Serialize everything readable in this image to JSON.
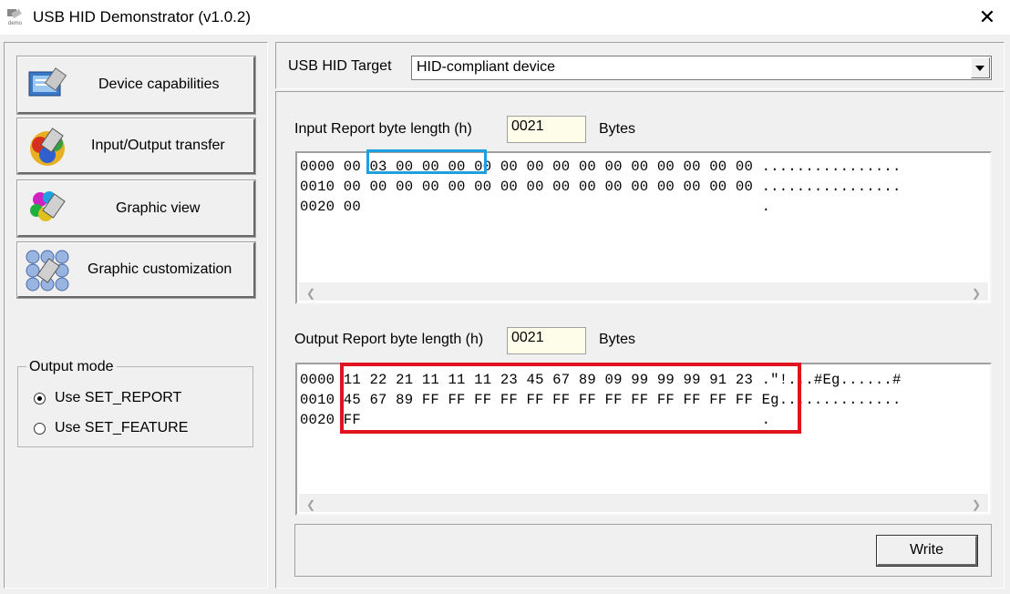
{
  "window": {
    "title": "USB HID Demonstrator (v1.0.2)",
    "close_glyph": "✕"
  },
  "sidebar": {
    "buttons": [
      {
        "label": "Device capabilities",
        "icon": "device-capabilities-icon"
      },
      {
        "label": "Input/Output transfer",
        "icon": "io-transfer-icon"
      },
      {
        "label": "Graphic view",
        "icon": "graphic-view-icon"
      },
      {
        "label": "Graphic customization",
        "icon": "graphic-customization-icon"
      }
    ],
    "output_mode": {
      "title": "Output mode",
      "options": [
        {
          "label": "Use SET_REPORT",
          "selected": true
        },
        {
          "label": "Use SET_FEATURE",
          "selected": false
        }
      ]
    }
  },
  "target": {
    "label": "USB HID Target",
    "value": "HID-compliant device"
  },
  "input_report": {
    "label": "Input Report byte length  (h)",
    "length": "0021",
    "unit": "Bytes",
    "rows": [
      {
        "addr": "0000",
        "bytes": [
          "00",
          "03",
          "00",
          "00",
          "00",
          "00",
          "00",
          "00",
          "00",
          "00",
          "00",
          "00",
          "00",
          "00",
          "00",
          "00"
        ],
        "ascii": "................"
      },
      {
        "addr": "0010",
        "bytes": [
          "00",
          "00",
          "00",
          "00",
          "00",
          "00",
          "00",
          "00",
          "00",
          "00",
          "00",
          "00",
          "00",
          "00",
          "00",
          "00"
        ],
        "ascii": "................"
      },
      {
        "addr": "0020",
        "bytes": [
          "00"
        ],
        "ascii": "."
      }
    ],
    "highlight_color": "#1f9fe0"
  },
  "output_report": {
    "label": "Output Report byte length  (h)",
    "length": "0021",
    "unit": "Bytes",
    "rows": [
      {
        "addr": "0000",
        "bytes": [
          "11",
          "22",
          "21",
          "11",
          "11",
          "11",
          "23",
          "45",
          "67",
          "89",
          "09",
          "99",
          "99",
          "99",
          "91",
          "23"
        ],
        "ascii": ".\"!...#Eg......#"
      },
      {
        "addr": "0010",
        "bytes": [
          "45",
          "67",
          "89",
          "FF",
          "FF",
          "FF",
          "FF",
          "FF",
          "FF",
          "FF",
          "FF",
          "FF",
          "FF",
          "FF",
          "FF",
          "FF"
        ],
        "ascii": "Eg.............."
      },
      {
        "addr": "0020",
        "bytes": [
          "FF"
        ],
        "ascii": "."
      }
    ],
    "highlight_color": "#e0141e"
  },
  "write_button": {
    "label": "Write"
  },
  "colors": {
    "window_bg": "#f0f0f0",
    "field_bg": "#fdfde9"
  }
}
